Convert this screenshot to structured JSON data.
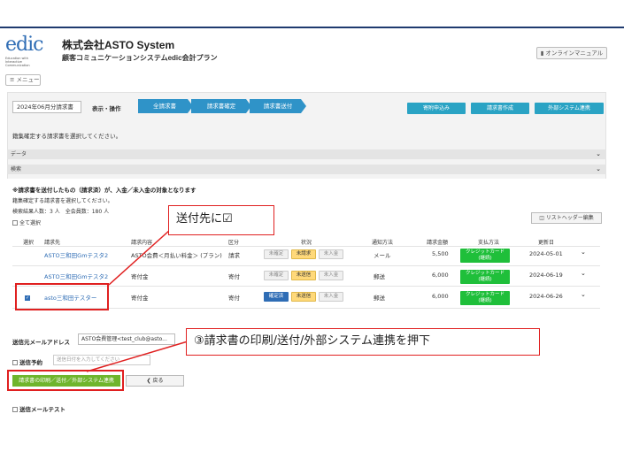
{
  "header": {
    "logo_text": "edic",
    "logo_sub": "Education with Interactive Communication",
    "company": "株式会社ASTO System",
    "product": "顧客コミュニケーションシステムedic会計プラン",
    "manual_button": "オンラインマニュアル",
    "menu_button": "メニュー"
  },
  "toolbar": {
    "month": "2024年06月分請求書",
    "op_label": "表示・操作",
    "steps": [
      "全請求書",
      "請求書確定",
      "請求書送付"
    ],
    "right_buttons": [
      "寄附申込み",
      "請求書作成",
      "外部システム連携"
    ]
  },
  "hint": "籍集確定する請求書を選択してください。",
  "sections": [
    "データ",
    "検索"
  ],
  "notes": {
    "bold": "※請求書を送付したもの（請求済）が、入金／未入金の対象となります",
    "line2": "籍集確定する請求書を選択してください。",
    "line3": "検索結果人数：3 人　全会員数：180 人",
    "select_all": "全て選択",
    "list_header_button": "リストヘッダー編集"
  },
  "table": {
    "headers": [
      "選択",
      "請求先",
      "請求内容",
      "区分",
      "状況",
      "通知方法",
      "請求金額",
      "支払方法",
      "更新日"
    ],
    "rows": [
      {
        "name": "ASTO三和田Gmテスタ2",
        "content": "ASTO会費＜月払い料金＞ (プラン)",
        "type": "請求",
        "status": [
          "未確定",
          "未請求",
          "未入金"
        ],
        "notify": "メール",
        "amount": "5,500",
        "pay": [
          "クレジットカード",
          "(継続)"
        ],
        "date": "2024-05-01",
        "checked": false
      },
      {
        "name": "ASTO三和田Gmテスタ2",
        "content": "寄付金",
        "type": "寄付",
        "status": [
          "未確定",
          "未送信",
          "未入金"
        ],
        "notify": "郵送",
        "amount": "6,000",
        "pay": [
          "クレジットカード",
          "(継続)"
        ],
        "date": "2024-06-19",
        "checked": false
      },
      {
        "name": "asto三和田テスター",
        "content": "寄付金",
        "type": "寄付",
        "status": [
          "確定済",
          "未送信",
          "未入金"
        ],
        "notify": "郵送",
        "amount": "6,000",
        "pay": [
          "クレジットカード",
          "(継続)"
        ],
        "date": "2024-06-26",
        "checked": true
      }
    ]
  },
  "footer": {
    "sender_label": "送信元メールアドレス",
    "sender_value": "ASTO会費管理<test_club@asto...",
    "schedule_label": "送信予約",
    "schedule_placeholder": "送信日付を入力してください",
    "print_button": "請求書の印刷／送付／外部システム連携",
    "back_button": "戻る",
    "test_mail": "送信メールテスト"
  },
  "callouts": {
    "c1": "送付先に☑",
    "c2": "③請求書の印刷/送付/外部システム連携を押下"
  },
  "colors": {
    "accent_blue": "#2f93c8",
    "callout_red": "#e02020",
    "credit_green": "#1fbf3a",
    "print_green": "#6fb52c"
  }
}
